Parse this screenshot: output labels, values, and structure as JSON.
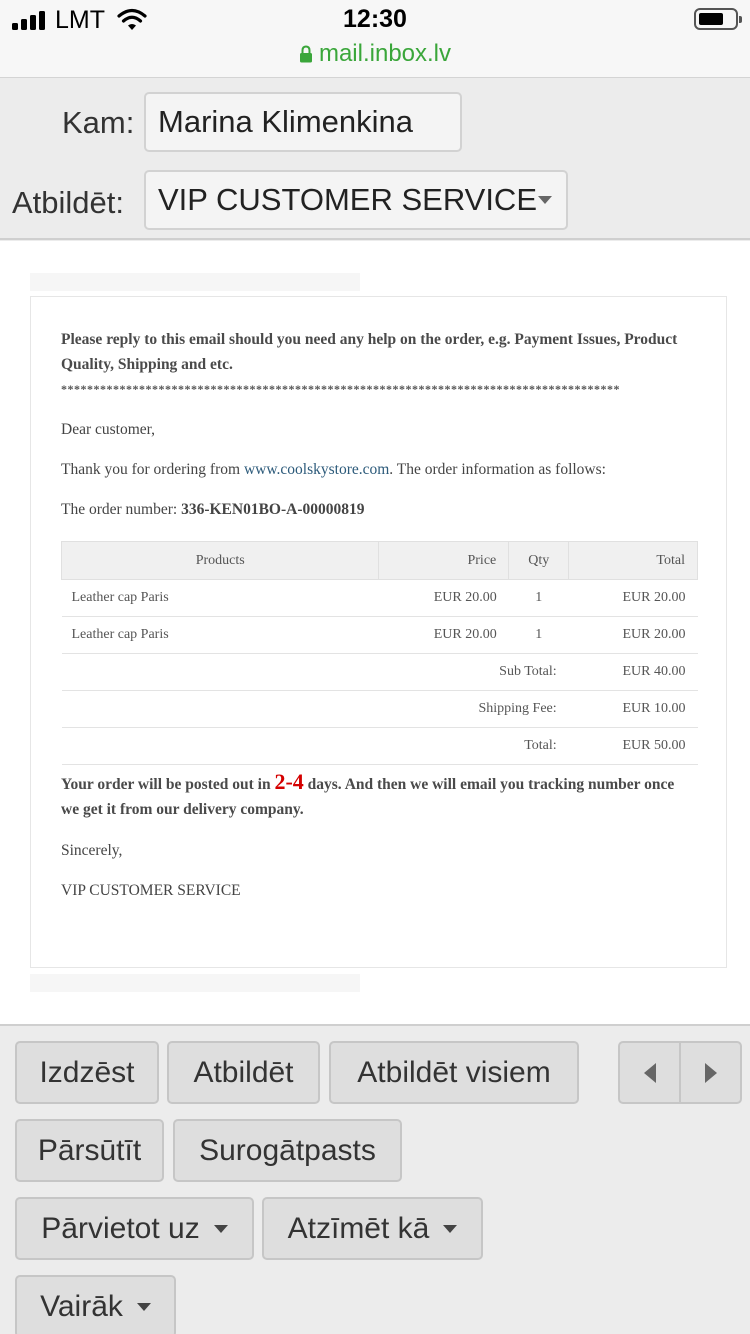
{
  "status": {
    "carrier": "LMT",
    "time": "12:30",
    "url": "mail.inbox.lv"
  },
  "header": {
    "to_label": "Kam:",
    "to_value": "Marina Klimenkina",
    "reply_label": "Atbildēt:",
    "reply_value": "VIP CUSTOMER SERVICE"
  },
  "email": {
    "intro": "Please reply to this email should you need any help on the order, e.g. Payment Issues, Product Quality, Shipping and etc.",
    "stars": "**************************************************************************************",
    "greeting": "Dear customer,",
    "thanks_before": "Thank you for ordering from ",
    "thanks_link": "www.coolskystore.com",
    "thanks_after": ". The order information as follows:",
    "order_label": "The order number: ",
    "order_number": "336-KEN01BO-A-00000819",
    "table": {
      "headers": [
        "Products",
        "Price",
        "Qty",
        "Total"
      ],
      "rows": [
        {
          "product": "Leather cap Paris",
          "price": "EUR 20.00",
          "qty": "1",
          "total": "EUR 20.00"
        },
        {
          "product": "Leather cap Paris",
          "price": "EUR 20.00",
          "qty": "1",
          "total": "EUR 20.00"
        }
      ],
      "subtotal_label": "Sub Total:",
      "subtotal_value": "EUR 40.00",
      "shipping_label": "Shipping Fee:",
      "shipping_value": "EUR 10.00",
      "total_label": "Total:",
      "total_value": "EUR 50.00"
    },
    "posted_before": "Your order will be posted out in ",
    "posted_days": "2-4",
    "posted_after": " days. And then we will email you tracking number once we get it from our delivery company.",
    "closing": "Sincerely,",
    "signature": "VIP CUSTOMER SERVICE"
  },
  "toolbar": {
    "delete": "Izdzēst",
    "reply": "Atbildēt",
    "reply_all": "Atbildēt visiem",
    "forward": "Pārsūtīt",
    "spam": "Surogātpasts",
    "move_to": "Pārvietot uz",
    "mark_as": "Atzīmēt kā",
    "more": "Vairāk"
  }
}
